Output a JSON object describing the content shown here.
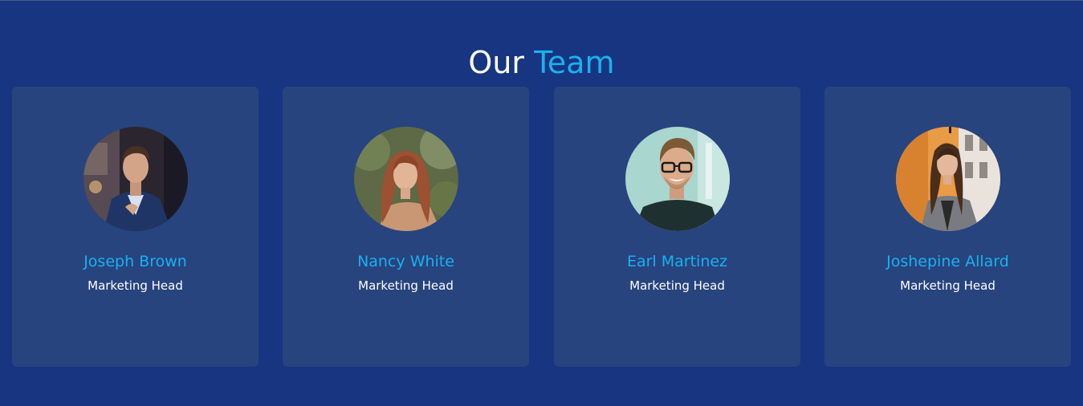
{
  "header": {
    "title_part1": "Our",
    "title_part2": "Team",
    "accent_color": "#1ab1ef",
    "background_color": "#173581"
  },
  "team": [
    {
      "name": "Joseph Brown",
      "role": "Marketing Head",
      "photo": "man-in-suit-photo"
    },
    {
      "name": "Nancy White",
      "role": "Marketing Head",
      "photo": "woman-red-hair-photo"
    },
    {
      "name": "Earl Martinez",
      "role": "Marketing Head",
      "photo": "man-glasses-photo"
    },
    {
      "name": "Joshepine Allard",
      "role": "Marketing Head",
      "photo": "woman-blazer-photo"
    }
  ]
}
